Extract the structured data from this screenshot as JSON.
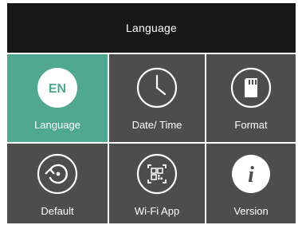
{
  "title": "Language",
  "tiles": [
    {
      "label": "Language",
      "icon": "en-badge-icon",
      "badge_text": "EN",
      "selected": true
    },
    {
      "label": "Date/ Time",
      "icon": "clock-icon"
    },
    {
      "label": "Format",
      "icon": "sd-card-icon"
    },
    {
      "label": "Default",
      "icon": "reset-icon"
    },
    {
      "label": "Wi-Fi App",
      "icon": "qr-code-icon"
    },
    {
      "label": "Version",
      "icon": "info-icon"
    }
  ],
  "colors": {
    "title_bar": "#171717",
    "tile": "#4d4d4d",
    "selected_tile": "#4fa88f",
    "divider": "#ffffff",
    "text": "#ffffff"
  }
}
